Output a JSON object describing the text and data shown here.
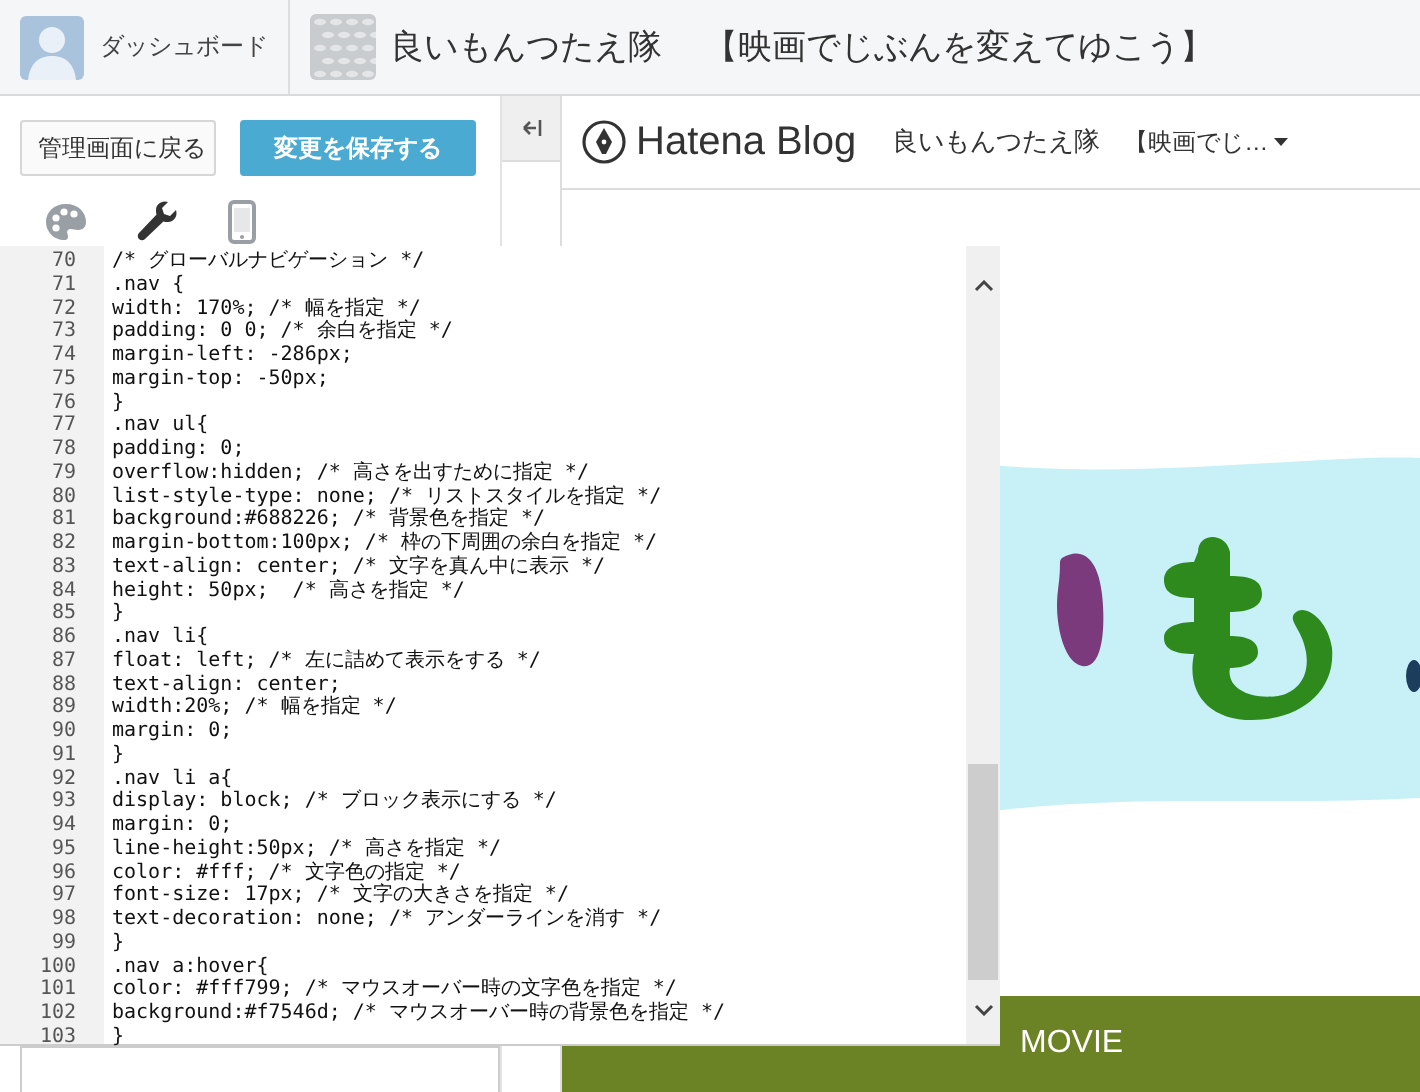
{
  "top_bar": {
    "dashboard_label": "ダッシュボード",
    "blog_name": "良いもんつたえ隊",
    "blog_subtitle": "【映画でじぶんを変えてゆこう】"
  },
  "sidebar": {
    "buttons": [
      {
        "label": "管理画面に戻る",
        "kind": "secondary"
      },
      {
        "label": "変更を保存する",
        "kind": "primary"
      }
    ],
    "tool_tabs": [
      {
        "kind": "palette",
        "selected": false
      },
      {
        "kind": "wrench",
        "selected": true
      },
      {
        "kind": "phone",
        "selected": false
      }
    ]
  },
  "preview": {
    "brand": "Hatena Blog",
    "blog_name": "良いもんつたえ隊",
    "blog_menu": "【映画でじ…",
    "nav": [
      {
        "label": "MOVIE"
      }
    ]
  },
  "editor": {
    "lines": [
      {
        "number": "70",
        "text": "/* グローバルナビゲーション */"
      },
      {
        "number": "71",
        "text": ".nav {"
      },
      {
        "number": "72",
        "text": "width: 170%; /* 幅を指定 */"
      },
      {
        "number": "73",
        "text": "padding: 0 0; /* 余白を指定 */"
      },
      {
        "number": "74",
        "text": "margin-left: -286px;"
      },
      {
        "number": "75",
        "text": "margin-top: -50px;"
      },
      {
        "number": "76",
        "text": "}"
      },
      {
        "number": "77",
        "text": ".nav ul{"
      },
      {
        "number": "78",
        "text": "padding: 0;"
      },
      {
        "number": "79",
        "text": "overflow:hidden; /* 高さを出すために指定 */"
      },
      {
        "number": "80",
        "text": "list-style-type: none; /* リストスタイルを指定 */"
      },
      {
        "number": "81",
        "text": "background:#688226; /* 背景色を指定 */"
      },
      {
        "number": "82",
        "text": "margin-bottom:100px; /* 枠の下周囲の余白を指定 */"
      },
      {
        "number": "83",
        "text": "text-align: center; /* 文字を真ん中に表示 */"
      },
      {
        "number": "84",
        "text": "height: 50px;  /* 高さを指定 */"
      },
      {
        "number": "85",
        "text": "}"
      },
      {
        "number": "86",
        "text": ".nav li{"
      },
      {
        "number": "87",
        "text": "float: left; /* 左に詰めて表示をする */"
      },
      {
        "number": "88",
        "text": "text-align: center;"
      },
      {
        "number": "89",
        "text": "width:20%; /* 幅を指定 */"
      },
      {
        "number": "90",
        "text": "margin: 0;"
      },
      {
        "number": "91",
        "text": "}"
      },
      {
        "number": "92",
        "text": ".nav li a{"
      },
      {
        "number": "93",
        "text": "display: block; /* ブロック表示にする */"
      },
      {
        "number": "94",
        "text": "margin: 0;"
      },
      {
        "number": "95",
        "text": "line-height:50px; /* 高さを指定 */"
      },
      {
        "number": "96",
        "text": "color: #fff; /* 文字色の指定 */"
      },
      {
        "number": "97",
        "text": "font-size: 17px; /* 文字の大きさを指定 */"
      },
      {
        "number": "98",
        "text": "text-decoration: none; /* アンダーラインを消す */"
      },
      {
        "number": "99",
        "text": "}"
      },
      {
        "number": "100",
        "text": ".nav a:hover{"
      },
      {
        "number": "101",
        "text": "color: #fff799; /* マウスオーバー時の文字色を指定 */"
      },
      {
        "number": "102",
        "text": "background:#f7546d; /* マウスオーバー時の背景色を指定 */"
      },
      {
        "number": "103",
        "text": "}"
      }
    ]
  }
}
